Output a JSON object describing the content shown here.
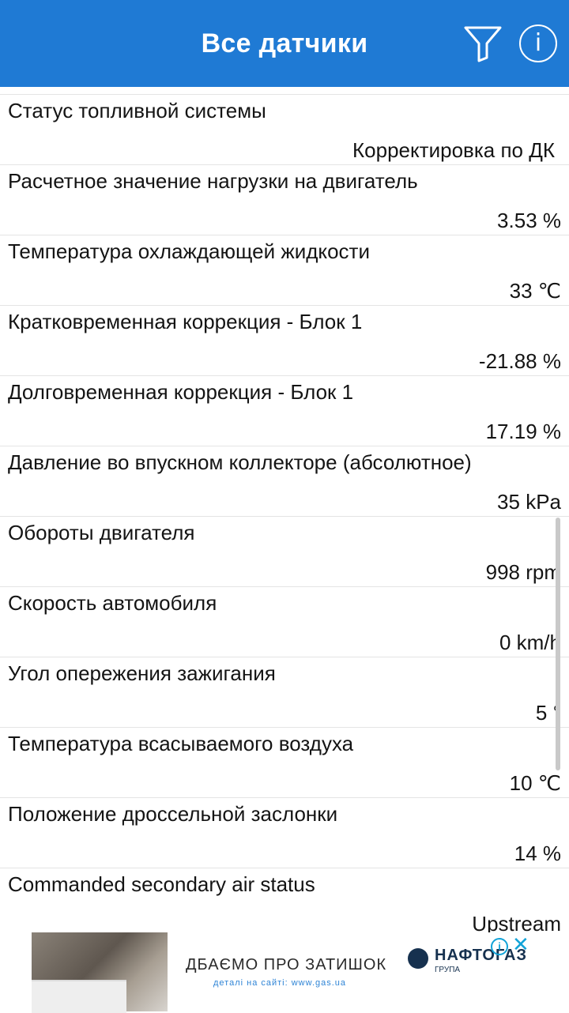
{
  "app": {
    "title": "Все датчики",
    "filter_icon": "filter-funnel-icon",
    "info_label": "i",
    "accent_color": "#1f7ad4"
  },
  "sensors": [
    {
      "name": "Статус топливной системы",
      "value": "Корректировка по ДК"
    },
    {
      "name": "Расчетное значение нагрузки на двигатель",
      "value": "3.53 %"
    },
    {
      "name": "Температура охлаждающей жидкости",
      "value": "33 ℃"
    },
    {
      "name": "Кратковременная коррекция - Блок 1",
      "value": "-21.88 %"
    },
    {
      "name": "Долговременная коррекция - Блок 1",
      "value": "17.19 %"
    },
    {
      "name": "Давление во впускном коллекторе (абсолютное)",
      "value": "35 kPa"
    },
    {
      "name": "Обороты двигателя",
      "value": "998 rpm"
    },
    {
      "name": "Скорость автомобиля",
      "value": "0 km/h"
    },
    {
      "name": "Угол опережения зажигания",
      "value": "5 °"
    },
    {
      "name": "Температура всасываемого воздуха",
      "value": "10 ℃"
    },
    {
      "name": "Положение дроссельной заслонки",
      "value": "14 %"
    },
    {
      "name": "Commanded secondary air status",
      "value": "Upstream"
    }
  ],
  "ad": {
    "headline": "ДБАЄМО ПРО ЗАТИШОК",
    "subtext": "деталі на сайті: www.gas.ua",
    "brand": "НАФТОГАЗ",
    "brand_sub": "ГРУПА",
    "info_label": "i",
    "close_label": "✕"
  }
}
